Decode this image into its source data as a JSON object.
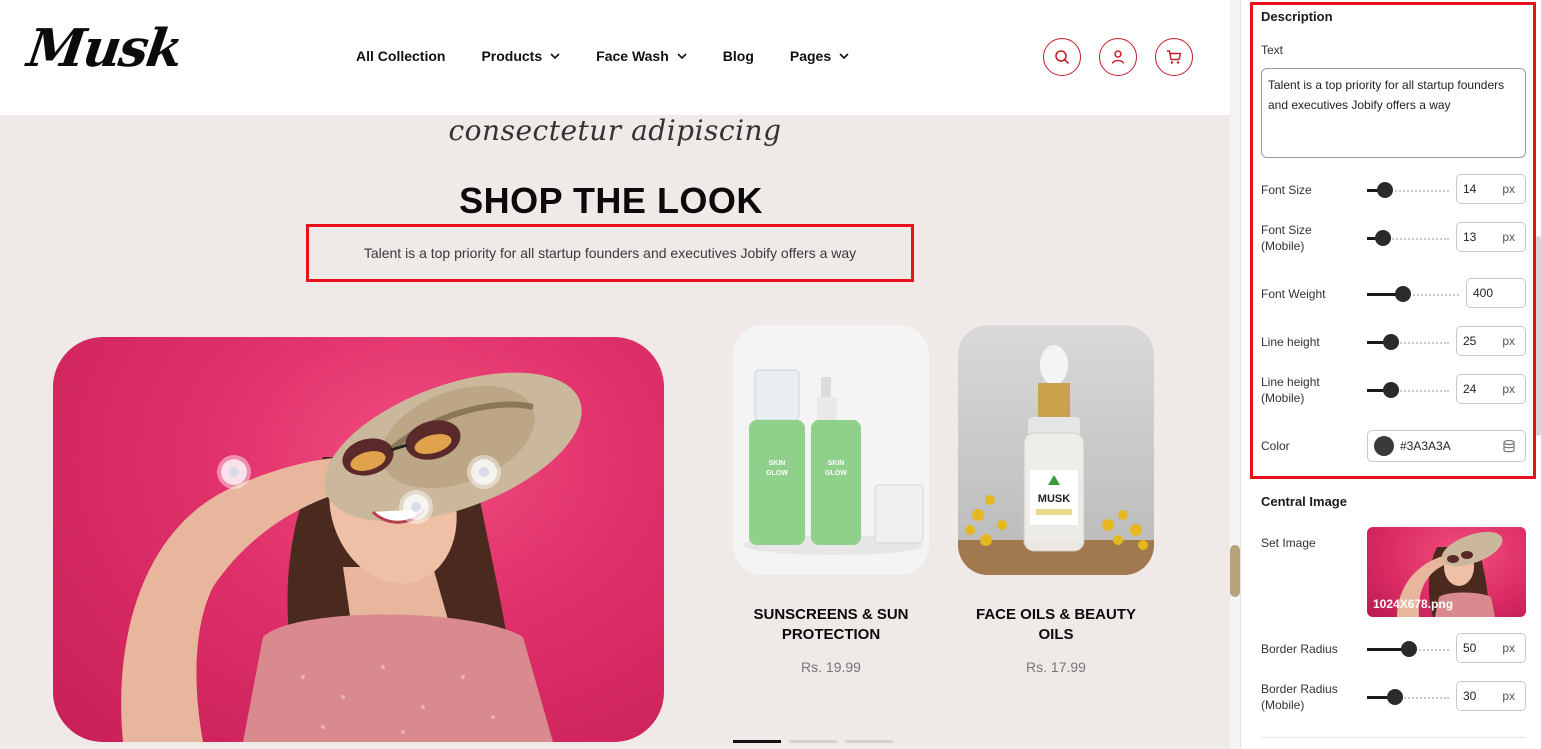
{
  "store": {
    "logo": "Musk",
    "nav": [
      {
        "label": "All Collection",
        "has_dropdown": false
      },
      {
        "label": "Products",
        "has_dropdown": true
      },
      {
        "label": "Face Wash",
        "has_dropdown": true
      },
      {
        "label": "Blog",
        "has_dropdown": false
      },
      {
        "label": "Pages",
        "has_dropdown": true
      }
    ],
    "header_icons": [
      "search-icon",
      "user-icon",
      "cart-icon"
    ],
    "accent_color": "#C41E2A"
  },
  "section": {
    "script_subtitle": "consectetur adipiscing",
    "title": "SHOP THE LOOK",
    "description": "Talent is a top priority for all startup founders and executives Jobify offers a way"
  },
  "products": [
    {
      "title": "SUNSCREENS & SUN PROTECTION",
      "price": "Rs. 19.99",
      "bottle_labels": [
        "SKIN",
        "GLOW"
      ]
    },
    {
      "title": "FACE OILS & BEAUTY OILS",
      "price": "Rs. 17.99",
      "bottle_labels": [
        "MUSK"
      ]
    }
  ],
  "carousel": {
    "pages": 3,
    "active": 0
  },
  "settings": {
    "description_heading": "Description",
    "text_label": "Text",
    "text_value": "Talent is a top priority for all startup founders and executives Jobify offers a way",
    "font_size": {
      "label": "Font Size",
      "value": "14",
      "unit": "px"
    },
    "font_size_mobile": {
      "label": "Font Size (Mobile)",
      "value": "13",
      "unit": "px"
    },
    "font_weight": {
      "label": "Font Weight",
      "value": "400"
    },
    "line_height": {
      "label": "Line height",
      "value": "25",
      "unit": "px"
    },
    "line_height_mobile": {
      "label": "Line height (Mobile)",
      "value": "24",
      "unit": "px"
    },
    "color": {
      "label": "Color",
      "value": "#3A3A3A"
    },
    "central_image_heading": "Central Image",
    "set_image_label": "Set Image",
    "image_filename": "1024X678.png",
    "border_radius": {
      "label": "Border Radius",
      "value": "50",
      "unit": "px"
    },
    "border_radius_mobile": {
      "label": "Border Radius (Mobile)",
      "value": "30",
      "unit": "px"
    }
  }
}
